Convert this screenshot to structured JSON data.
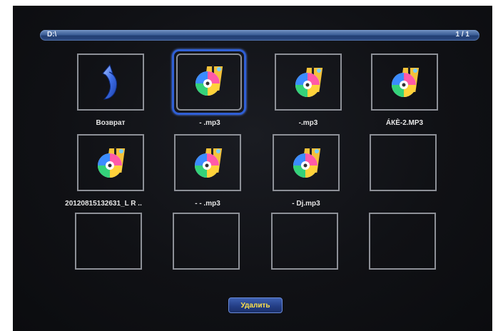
{
  "path": "D:\\",
  "page_indicator": "1 / 1",
  "tiles": [
    {
      "label": "Возврат",
      "icon": "back-arrow-icon"
    },
    {
      "label": "-  .mp3",
      "icon": "music-disc-icon"
    },
    {
      "label": "-.mp3",
      "icon": "music-disc-icon"
    },
    {
      "label": "ÁКÈ-2.MP3",
      "icon": "music-disc-icon"
    },
    {
      "label": "20120815132631_L  R  ..",
      "icon": "music-disc-icon"
    },
    {
      "label": "-   -   .mp3",
      "icon": "music-disc-icon"
    },
    {
      "label": "- Dj.mp3",
      "icon": "music-disc-icon"
    },
    {
      "label": "",
      "icon": ""
    },
    {
      "label": "",
      "icon": ""
    },
    {
      "label": "",
      "icon": ""
    },
    {
      "label": "",
      "icon": ""
    },
    {
      "label": "",
      "icon": ""
    }
  ],
  "delete_label": "Удалить",
  "colors": {
    "accent": "#2f5fd6",
    "button_text": "#ffe24a"
  }
}
